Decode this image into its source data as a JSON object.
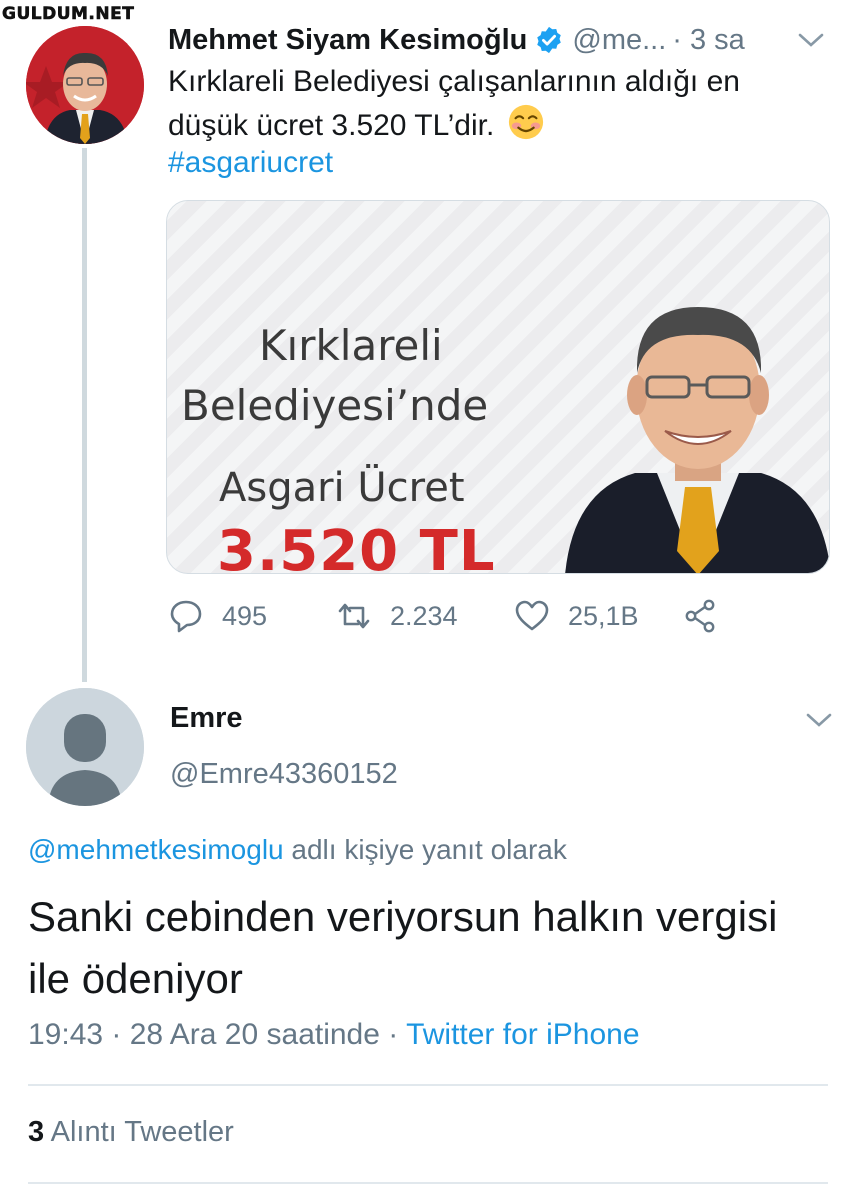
{
  "watermark": "GULDUM.NET",
  "colors": {
    "link": "#1b95e0",
    "muted": "#657786",
    "text": "#14171a",
    "accent_red": "#d42a2a"
  },
  "tweet": {
    "author_name": "Mehmet Siyam Kesimoğlu",
    "verified_icon": "verified-badge-icon",
    "handle": "@me...",
    "time": "· 3 sa",
    "text": "Kırklareli Belediyesi çalışanlarının aldığı en düşük ücret 3.520 TL’dir.",
    "emoji": "smiling-face-with-blush-emoji",
    "hashtag": "#asgariucret",
    "media": {
      "line1": "Kırklareli",
      "line2": "Belediyesi’nde",
      "line3": "Asgari Ücret",
      "price": "3.520 TL"
    },
    "actions": {
      "replies": "495",
      "retweets": "2.234",
      "likes": "25,1B"
    }
  },
  "reply": {
    "author_name": "Emre",
    "handle": "@Emre43360152",
    "replying_mention": "@mehmetkesimoglu",
    "replying_suffix": "adlı kişiye yanıt olarak",
    "text": "Sanki cebinden veriyorsun halkın vergisi ile ödeniyor",
    "timestamp": "19:43 · 28 Ara 20 saatinde ·",
    "source": "Twitter for iPhone"
  },
  "quote_tweets": {
    "count": "3",
    "label": "Alıntı Tweetler"
  }
}
